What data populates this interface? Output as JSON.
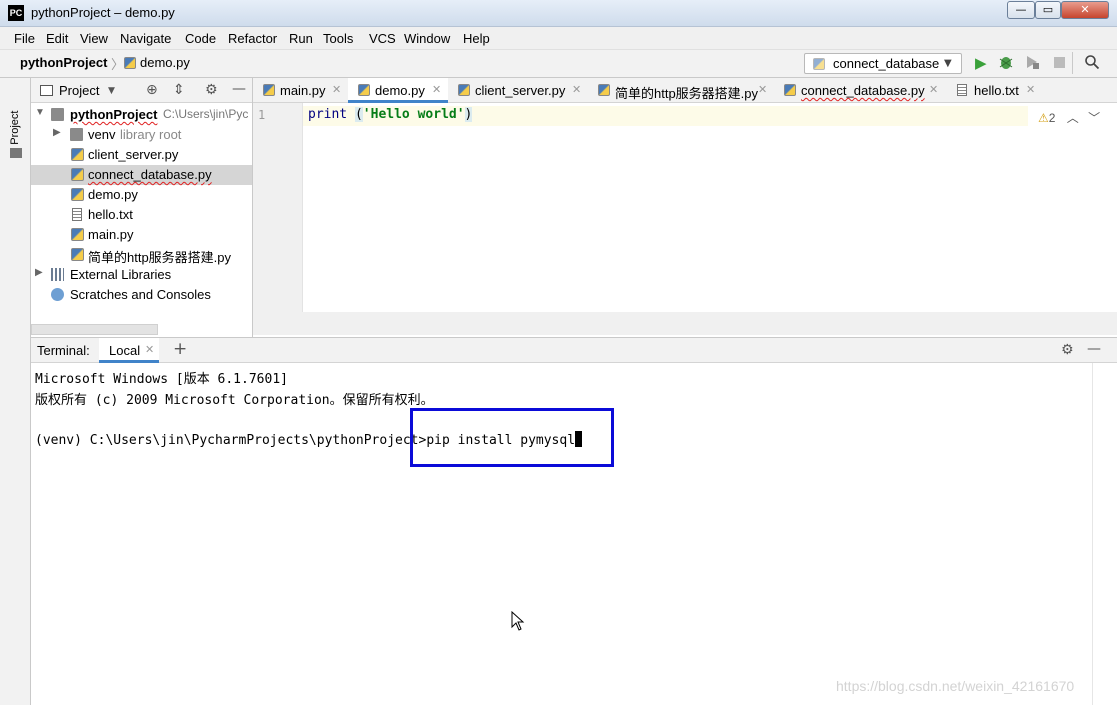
{
  "window": {
    "logo": "PC",
    "title": "pythonProject – demo.py",
    "minimize": "—",
    "maximize": "▭",
    "close": "✕"
  },
  "menu": [
    "File",
    "Edit",
    "View",
    "Navigate",
    "Code",
    "Refactor",
    "Run",
    "Tools",
    "VCS",
    "Window",
    "Help"
  ],
  "navbar": {
    "project": "pythonProject",
    "file": "demo.py",
    "run_config": "connect_database"
  },
  "tool_strip": {
    "project_label": "1: Project"
  },
  "project_panel": {
    "title": "Project",
    "root": {
      "name": "pythonProject",
      "path": "C:\\Users\\jin\\Pyc"
    },
    "venv": {
      "name": "venv",
      "note": "library root"
    },
    "files": [
      "client_server.py",
      "connect_database.py",
      "demo.py",
      "hello.txt",
      "main.py",
      "简单的http服务器搭建.py"
    ],
    "selected_file": "connect_database.py",
    "external_libraries": "External Libraries",
    "scratches": "Scratches and Consoles"
  },
  "editor": {
    "tabs": [
      "main.py",
      "demo.py",
      "client_server.py",
      "简单的http服务器搭建.py",
      "connect_database.py",
      "hello.txt"
    ],
    "active_tab": "demo.py",
    "line_number": "1",
    "code": {
      "keyword": "print",
      "open_paren": "(",
      "string": "'Hello world'",
      "close_paren": ")"
    },
    "warnings": "2"
  },
  "terminal": {
    "label": "Terminal:",
    "tab": "Local",
    "lines": [
      "Microsoft Windows [版本 6.1.7601]",
      "版权所有 (c) 2009 Microsoft Corporation。保留所有权利。",
      "",
      "(venv) C:\\Users\\jin\\PycharmProjects\\pythonProject>pip install pymysql"
    ]
  },
  "watermark": "https://blog.csdn.net/weixin_42161670"
}
